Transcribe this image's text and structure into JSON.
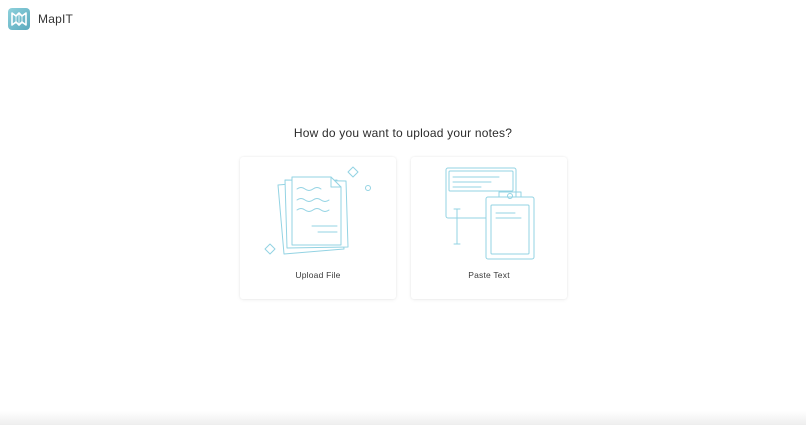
{
  "app": {
    "name": "MapIT",
    "brand_color": "#6cbccb",
    "logo_icon": "map-logo-icon"
  },
  "main": {
    "question": "How do you want to upload your notes?",
    "options": [
      {
        "label": "Upload File",
        "icon": "upload-file-illustration"
      },
      {
        "label": "Paste Text",
        "icon": "paste-text-illustration"
      }
    ],
    "illustration_color": "#93d3e3"
  }
}
